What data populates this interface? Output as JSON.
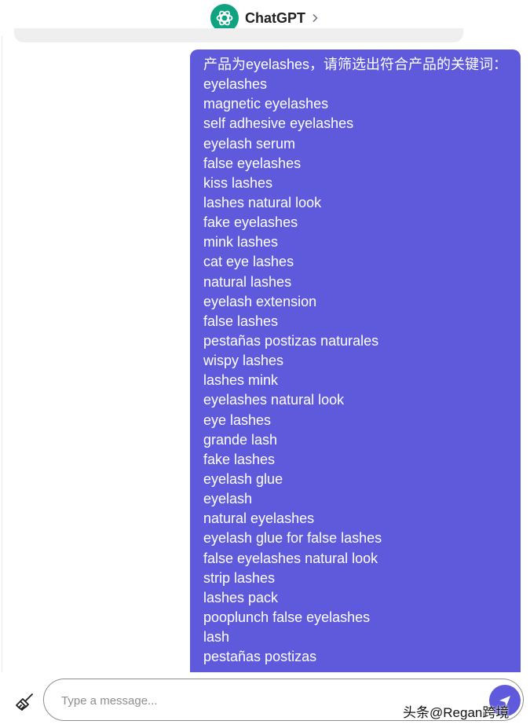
{
  "header": {
    "title": "ChatGPT",
    "logo_icon": "openai-logo-icon",
    "chevron_icon": "chevron-right-icon",
    "logo_color": "#10a37f"
  },
  "message": {
    "color": "#5e5adb",
    "lines": [
      "产品为eyelashes，请筛选出符合产品的关键词：",
      "eyelashes",
      "magnetic eyelashes",
      "self adhesive eyelashes",
      "eyelash serum",
      "false eyelashes",
      "kiss lashes",
      "lashes natural look",
      "fake eyelashes",
      "mink lashes",
      "cat eye lashes",
      "natural lashes",
      "eyelash extension",
      "false lashes",
      "pestañas postizas naturales",
      "wispy lashes",
      "lashes mink",
      "eyelashes natural look",
      "eye lashes",
      "grande lash",
      "fake lashes",
      "eyelash glue",
      "eyelash",
      "natural eyelashes",
      "eyelash glue for false lashes",
      "false eyelashes natural look",
      "strip lashes",
      "lashes pack",
      "pooplunch false eyelashes",
      "lash",
      "pestañas postizas"
    ]
  },
  "composer": {
    "placeholder": "Type a message...",
    "value": "",
    "clear_icon": "broom-icon",
    "send_icon": "send-icon"
  },
  "watermark": {
    "text": "头条@Regan跨境"
  }
}
